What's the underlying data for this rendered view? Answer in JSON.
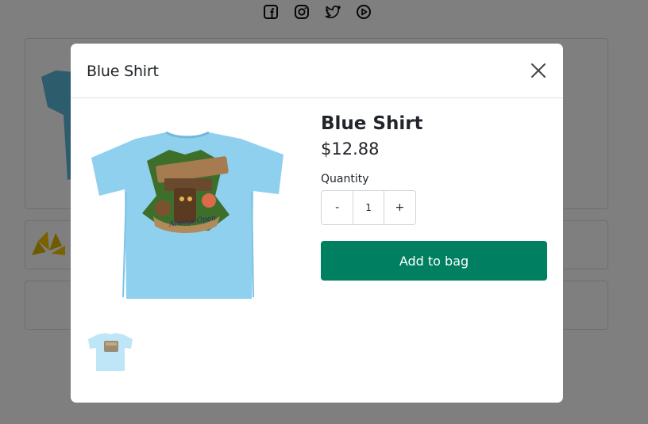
{
  "social_icons": [
    "facebook-icon",
    "instagram-icon",
    "twitter-icon",
    "youtube-icon"
  ],
  "modal": {
    "title": "Blue Shirt",
    "close_icon": "close-icon"
  },
  "product": {
    "name": "Blue Shirt",
    "price": "$12.88",
    "quantity_label": "Quantity",
    "quantity_minus": "-",
    "quantity_value": "1",
    "quantity_plus": "+",
    "add_to_bag_label": "Add to bag",
    "shirt_color": "#8fd0ef"
  },
  "colors": {
    "accent": "#008060",
    "overlay": "rgba(0,0,0,0.5)"
  }
}
